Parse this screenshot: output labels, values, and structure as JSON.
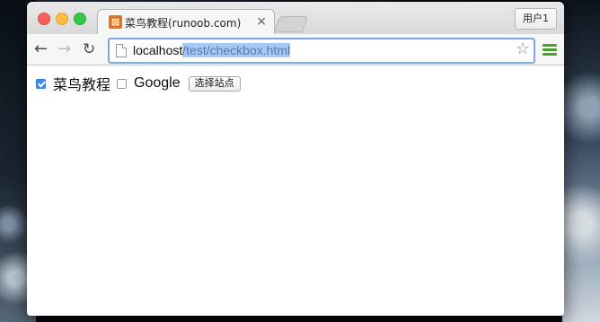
{
  "browser": {
    "tab": {
      "favicon": "runoob-favicon-icon",
      "title": "菜鸟教程(runoob.com)",
      "close": "×"
    },
    "user_button": "用户1",
    "nav": {
      "back": "←",
      "forward": "→",
      "reload": "↻"
    },
    "address": {
      "host": "localhost",
      "path": "/test/checkbox.html"
    },
    "star": "☆"
  },
  "page": {
    "options": [
      {
        "label": "菜鸟教程",
        "checked": true
      },
      {
        "label": "Google",
        "checked": false
      }
    ],
    "submit_button": "选择站点"
  },
  "colors": {
    "accent": "#3b8ef0",
    "menu": "#4aa02c",
    "selection": "#a9c9f2"
  }
}
